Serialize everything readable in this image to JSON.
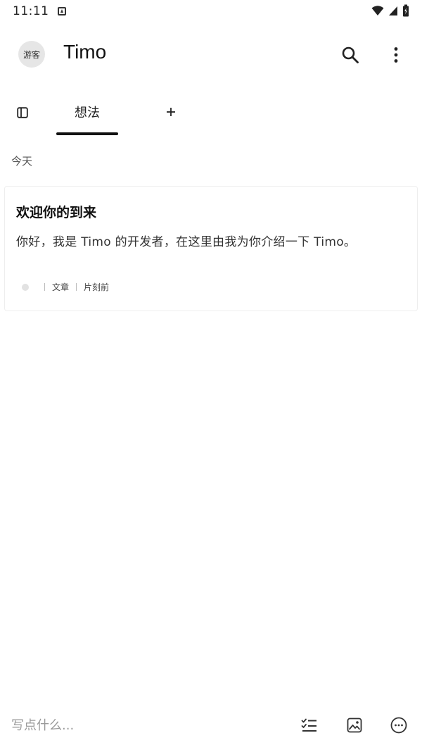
{
  "status_bar": {
    "time": "11:11"
  },
  "app_bar": {
    "avatar_label": "游客",
    "title": "Timo"
  },
  "tabs": [
    {
      "label": "想法",
      "active": true
    }
  ],
  "section": {
    "label": "今天"
  },
  "card": {
    "title": "欢迎你的到来",
    "body": "你好，我是 Timo 的开发者，在这里由我为你介绍一下 Timo。",
    "type": "文章",
    "time": "片刻前"
  },
  "composer": {
    "placeholder": "写点什么..."
  },
  "colors": {
    "background": "#ffffff",
    "text": "#111111",
    "tab_indicator": "#111111",
    "avatar_bg": "#e6e6e6",
    "placeholder": "#9a9a9a"
  },
  "icons": {
    "search": "search-icon",
    "more": "more-vert-icon",
    "sidebar": "sidebar-toggle-icon",
    "add": "plus-icon",
    "checklist": "checklist-icon",
    "image": "image-icon",
    "more_horiz": "more-horiz-circle-icon"
  }
}
